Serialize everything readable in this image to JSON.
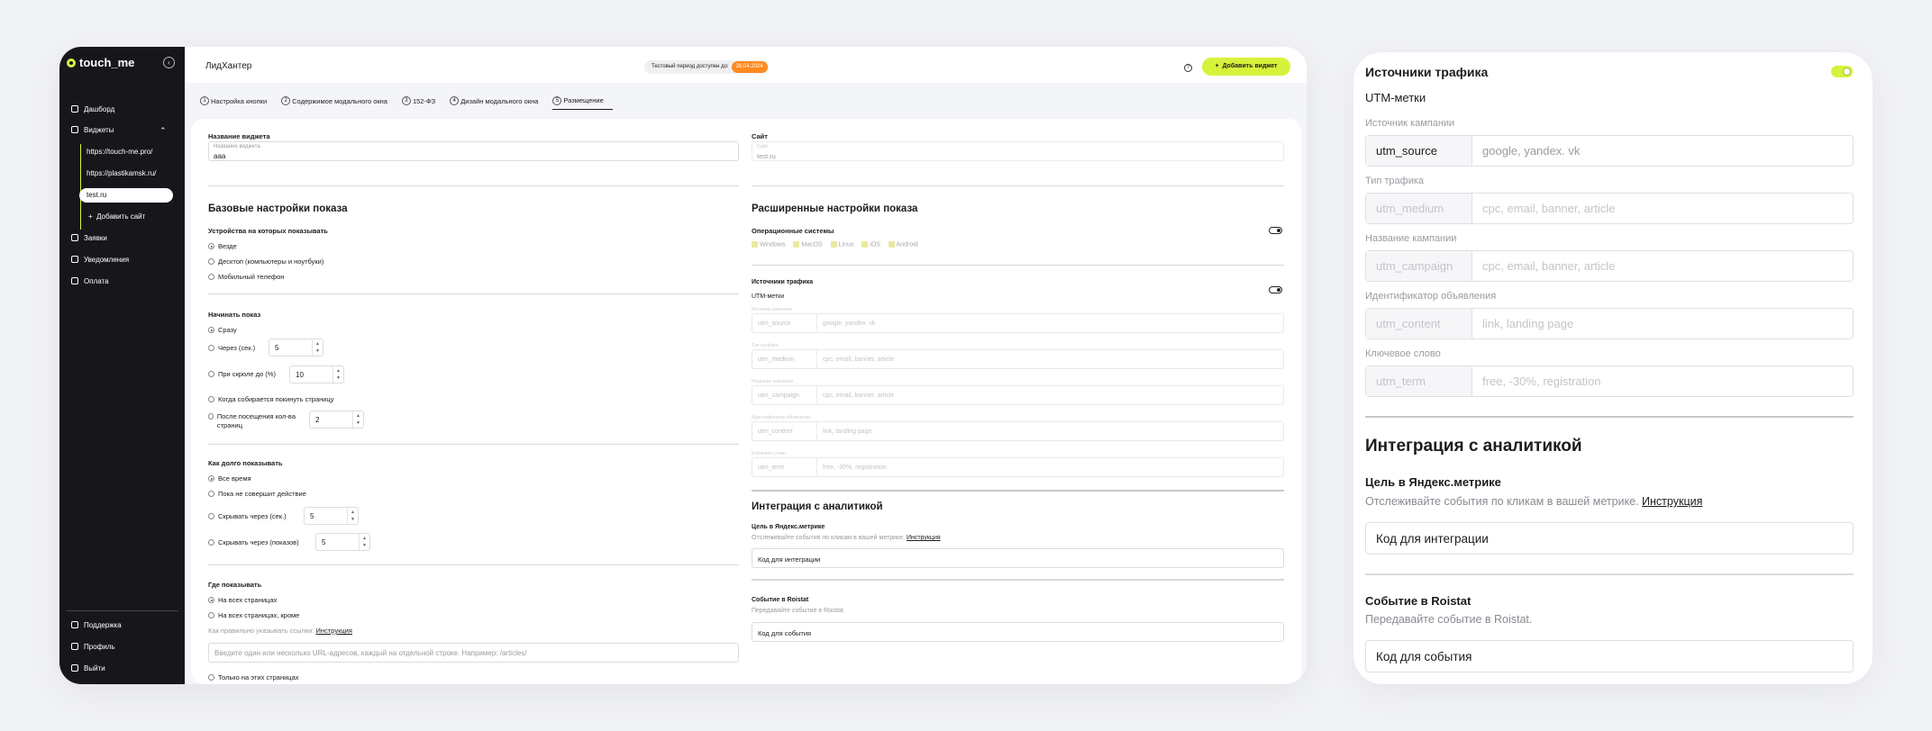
{
  "app": {
    "logo": "touch_me",
    "title": "ЛидХантер"
  },
  "trial": {
    "label": "Тестовый период доступен до:",
    "date": "28.04.2024"
  },
  "header": {
    "add_widget": "Добавить виджет"
  },
  "sidebar": {
    "items": [
      {
        "label": "Дашборд"
      },
      {
        "label": "Виджеты"
      },
      {
        "label": "Заявки"
      },
      {
        "label": "Уведомления"
      },
      {
        "label": "Оплата"
      }
    ],
    "sites": [
      "https://touch-me.pro/",
      "https://plastikamsk.ru/",
      "test.ru"
    ],
    "add_site": "Добавить сайт",
    "bottom": [
      {
        "label": "Поддержка"
      },
      {
        "label": "Профиль"
      },
      {
        "label": "Выйти"
      }
    ]
  },
  "tabs": [
    {
      "num": "1",
      "label": "Настройка кнопки"
    },
    {
      "num": "2",
      "label": "Содержимое модального окна"
    },
    {
      "num": "3",
      "label": "152-ФЗ"
    },
    {
      "num": "4",
      "label": "Дизайн модального окна"
    },
    {
      "num": "5",
      "label": "Размещение"
    }
  ],
  "form": {
    "widget_name_label": "Название виджета",
    "widget_name_float": "Название виджета",
    "widget_name_value": "ааа",
    "site_label": "Сайт",
    "site_float": "Сайт",
    "site_value": "test.ru",
    "basic_title": "Базовые настройки показа",
    "devices_label": "Устройства на которых показывать",
    "devices": [
      "Везде",
      "Десктоп (компьютеры и ноутбуки)",
      "Мобильный телефон"
    ],
    "start_label": "Начинать показ",
    "start": {
      "immediately": "Сразу",
      "after_sec": "Через (сек.)",
      "after_sec_value": "5",
      "scroll": "При скроле до (%)",
      "scroll_value": "10",
      "leave": "Когда собирается покинуть страницу",
      "pages": "После посещения кол-ва страниц",
      "pages_value": "2"
    },
    "duration_label": "Как долго показывать",
    "duration": {
      "always": "Все время",
      "until": "Пока не совершит действие",
      "hide_sec": "Скрывать через (сек.)",
      "hide_sec_value": "5",
      "hide_views": "Скрывать через (показов)",
      "hide_views_value": "5"
    },
    "where_label": "Где показывать",
    "where": [
      "На всех страницах",
      "На всех страницах, кроме"
    ],
    "url_hint": "Как правильно указывать ссылки:",
    "instruction": "Инструкция",
    "url_placeholder": "Введите один или несколько URL-адресов, каждый на отдельной строке. Например: /articles/",
    "only_pages": "Только на этих страницах",
    "advanced_title": "Расширенные настройки показа",
    "os_label": "Операционные системы",
    "os": [
      "Windows",
      "MacOS",
      "Linux",
      "iOS",
      "Android"
    ],
    "traffic_label": "Источники трафика",
    "utm_label": "UTM-метки",
    "utm": [
      {
        "label": "Источник кампании",
        "key": "utm_source",
        "placeholder": "google, yandex. vk"
      },
      {
        "label": "Тип трафика",
        "key": "utm_medium",
        "placeholder": "cpc, email, banner, article"
      },
      {
        "label": "Название кампании",
        "key": "utm_campaign",
        "placeholder": "cpc, email, banner, article"
      },
      {
        "label": "Идентификатор объявления",
        "key": "utm_content",
        "placeholder": "link, landing page"
      },
      {
        "label": "Ключевое слово",
        "key": "utm_term",
        "placeholder": "free, -30%, registration"
      }
    ],
    "analytics_title": "Интеграция с аналитикой",
    "ym_label": "Цель в Яндекс.метрике",
    "ym_desc": "Отслеживайте события по кликам в вашей метрике.",
    "ym_placeholder": "Код для интеграции",
    "roistat_label": "Событие в Roistat",
    "roistat_desc": "Передавайте событие в Roistat.",
    "roistat_placeholder": "Код для события"
  },
  "colors": {
    "accent": "#d7f23a",
    "trial_badge": "#ff8a1f",
    "sidebar_bg": "#17171b"
  }
}
